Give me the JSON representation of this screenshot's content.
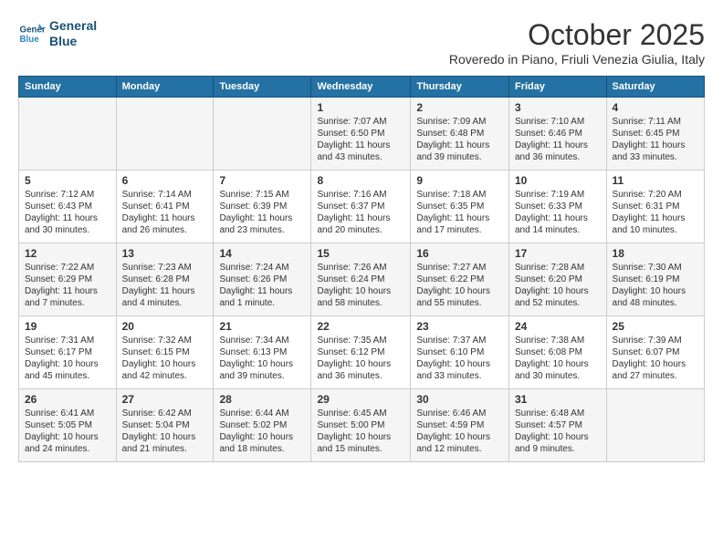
{
  "header": {
    "logo_line1": "General",
    "logo_line2": "Blue",
    "month": "October 2025",
    "location": "Roveredo in Piano, Friuli Venezia Giulia, Italy"
  },
  "days_of_week": [
    "Sunday",
    "Monday",
    "Tuesday",
    "Wednesday",
    "Thursday",
    "Friday",
    "Saturday"
  ],
  "weeks": [
    [
      {
        "day": "",
        "sunrise": "",
        "sunset": "",
        "daylight": ""
      },
      {
        "day": "",
        "sunrise": "",
        "sunset": "",
        "daylight": ""
      },
      {
        "day": "",
        "sunrise": "",
        "sunset": "",
        "daylight": ""
      },
      {
        "day": "1",
        "sunrise": "Sunrise: 7:07 AM",
        "sunset": "Sunset: 6:50 PM",
        "daylight": "Daylight: 11 hours and 43 minutes."
      },
      {
        "day": "2",
        "sunrise": "Sunrise: 7:09 AM",
        "sunset": "Sunset: 6:48 PM",
        "daylight": "Daylight: 11 hours and 39 minutes."
      },
      {
        "day": "3",
        "sunrise": "Sunrise: 7:10 AM",
        "sunset": "Sunset: 6:46 PM",
        "daylight": "Daylight: 11 hours and 36 minutes."
      },
      {
        "day": "4",
        "sunrise": "Sunrise: 7:11 AM",
        "sunset": "Sunset: 6:45 PM",
        "daylight": "Daylight: 11 hours and 33 minutes."
      }
    ],
    [
      {
        "day": "5",
        "sunrise": "Sunrise: 7:12 AM",
        "sunset": "Sunset: 6:43 PM",
        "daylight": "Daylight: 11 hours and 30 minutes."
      },
      {
        "day": "6",
        "sunrise": "Sunrise: 7:14 AM",
        "sunset": "Sunset: 6:41 PM",
        "daylight": "Daylight: 11 hours and 26 minutes."
      },
      {
        "day": "7",
        "sunrise": "Sunrise: 7:15 AM",
        "sunset": "Sunset: 6:39 PM",
        "daylight": "Daylight: 11 hours and 23 minutes."
      },
      {
        "day": "8",
        "sunrise": "Sunrise: 7:16 AM",
        "sunset": "Sunset: 6:37 PM",
        "daylight": "Daylight: 11 hours and 20 minutes."
      },
      {
        "day": "9",
        "sunrise": "Sunrise: 7:18 AM",
        "sunset": "Sunset: 6:35 PM",
        "daylight": "Daylight: 11 hours and 17 minutes."
      },
      {
        "day": "10",
        "sunrise": "Sunrise: 7:19 AM",
        "sunset": "Sunset: 6:33 PM",
        "daylight": "Daylight: 11 hours and 14 minutes."
      },
      {
        "day": "11",
        "sunrise": "Sunrise: 7:20 AM",
        "sunset": "Sunset: 6:31 PM",
        "daylight": "Daylight: 11 hours and 10 minutes."
      }
    ],
    [
      {
        "day": "12",
        "sunrise": "Sunrise: 7:22 AM",
        "sunset": "Sunset: 6:29 PM",
        "daylight": "Daylight: 11 hours and 7 minutes."
      },
      {
        "day": "13",
        "sunrise": "Sunrise: 7:23 AM",
        "sunset": "Sunset: 6:28 PM",
        "daylight": "Daylight: 11 hours and 4 minutes."
      },
      {
        "day": "14",
        "sunrise": "Sunrise: 7:24 AM",
        "sunset": "Sunset: 6:26 PM",
        "daylight": "Daylight: 11 hours and 1 minute."
      },
      {
        "day": "15",
        "sunrise": "Sunrise: 7:26 AM",
        "sunset": "Sunset: 6:24 PM",
        "daylight": "Daylight: 10 hours and 58 minutes."
      },
      {
        "day": "16",
        "sunrise": "Sunrise: 7:27 AM",
        "sunset": "Sunset: 6:22 PM",
        "daylight": "Daylight: 10 hours and 55 minutes."
      },
      {
        "day": "17",
        "sunrise": "Sunrise: 7:28 AM",
        "sunset": "Sunset: 6:20 PM",
        "daylight": "Daylight: 10 hours and 52 minutes."
      },
      {
        "day": "18",
        "sunrise": "Sunrise: 7:30 AM",
        "sunset": "Sunset: 6:19 PM",
        "daylight": "Daylight: 10 hours and 48 minutes."
      }
    ],
    [
      {
        "day": "19",
        "sunrise": "Sunrise: 7:31 AM",
        "sunset": "Sunset: 6:17 PM",
        "daylight": "Daylight: 10 hours and 45 minutes."
      },
      {
        "day": "20",
        "sunrise": "Sunrise: 7:32 AM",
        "sunset": "Sunset: 6:15 PM",
        "daylight": "Daylight: 10 hours and 42 minutes."
      },
      {
        "day": "21",
        "sunrise": "Sunrise: 7:34 AM",
        "sunset": "Sunset: 6:13 PM",
        "daylight": "Daylight: 10 hours and 39 minutes."
      },
      {
        "day": "22",
        "sunrise": "Sunrise: 7:35 AM",
        "sunset": "Sunset: 6:12 PM",
        "daylight": "Daylight: 10 hours and 36 minutes."
      },
      {
        "day": "23",
        "sunrise": "Sunrise: 7:37 AM",
        "sunset": "Sunset: 6:10 PM",
        "daylight": "Daylight: 10 hours and 33 minutes."
      },
      {
        "day": "24",
        "sunrise": "Sunrise: 7:38 AM",
        "sunset": "Sunset: 6:08 PM",
        "daylight": "Daylight: 10 hours and 30 minutes."
      },
      {
        "day": "25",
        "sunrise": "Sunrise: 7:39 AM",
        "sunset": "Sunset: 6:07 PM",
        "daylight": "Daylight: 10 hours and 27 minutes."
      }
    ],
    [
      {
        "day": "26",
        "sunrise": "Sunrise: 6:41 AM",
        "sunset": "Sunset: 5:05 PM",
        "daylight": "Daylight: 10 hours and 24 minutes."
      },
      {
        "day": "27",
        "sunrise": "Sunrise: 6:42 AM",
        "sunset": "Sunset: 5:04 PM",
        "daylight": "Daylight: 10 hours and 21 minutes."
      },
      {
        "day": "28",
        "sunrise": "Sunrise: 6:44 AM",
        "sunset": "Sunset: 5:02 PM",
        "daylight": "Daylight: 10 hours and 18 minutes."
      },
      {
        "day": "29",
        "sunrise": "Sunrise: 6:45 AM",
        "sunset": "Sunset: 5:00 PM",
        "daylight": "Daylight: 10 hours and 15 minutes."
      },
      {
        "day": "30",
        "sunrise": "Sunrise: 6:46 AM",
        "sunset": "Sunset: 4:59 PM",
        "daylight": "Daylight: 10 hours and 12 minutes."
      },
      {
        "day": "31",
        "sunrise": "Sunrise: 6:48 AM",
        "sunset": "Sunset: 4:57 PM",
        "daylight": "Daylight: 10 hours and 9 minutes."
      },
      {
        "day": "",
        "sunrise": "",
        "sunset": "",
        "daylight": ""
      }
    ]
  ]
}
